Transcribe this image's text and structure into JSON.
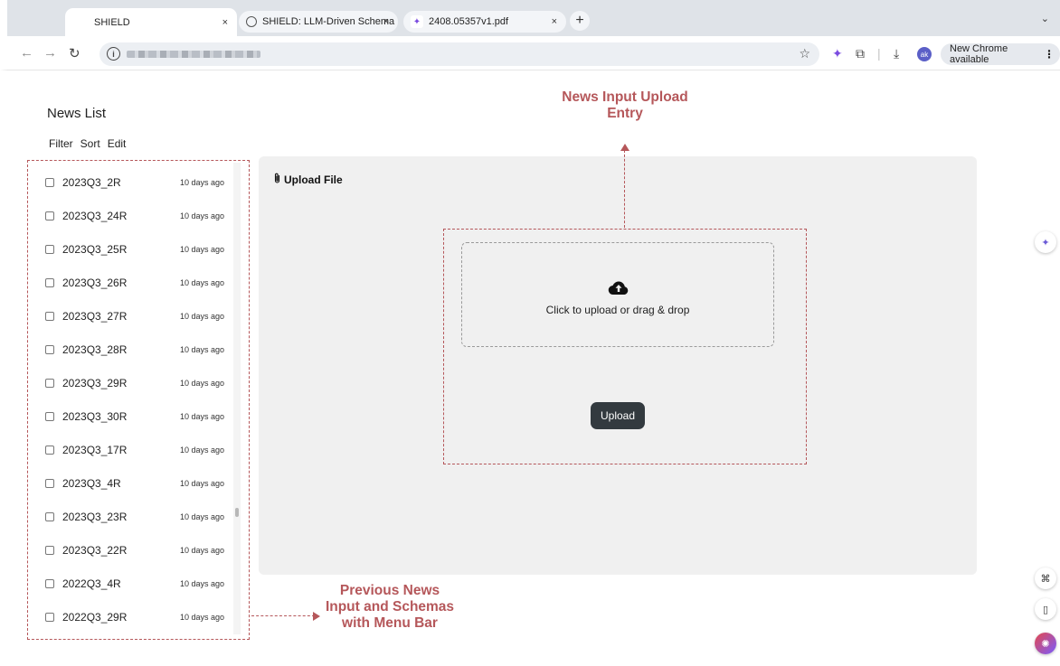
{
  "browser": {
    "tabs": [
      {
        "label": "SHIELD",
        "close": "×",
        "active": true
      },
      {
        "label": "SHIELD: LLM-Driven Schema",
        "close": "×",
        "active": false
      },
      {
        "label": "2408.05357v1.pdf",
        "close": "×",
        "active": false
      }
    ],
    "new_tab": "+",
    "tab_menu": "⌄",
    "update_label": "New Chrome available",
    "avatar_initials": "ak"
  },
  "page": {
    "title": "News List",
    "menu": [
      "Filter",
      "Sort",
      "Edit"
    ]
  },
  "news_items": [
    {
      "name": "2023Q3_2R",
      "time": "10 days ago"
    },
    {
      "name": "2023Q3_24R",
      "time": "10 days ago"
    },
    {
      "name": "2023Q3_25R",
      "time": "10 days ago"
    },
    {
      "name": "2023Q3_26R",
      "time": "10 days ago"
    },
    {
      "name": "2023Q3_27R",
      "time": "10 days ago"
    },
    {
      "name": "2023Q3_28R",
      "time": "10 days ago"
    },
    {
      "name": "2023Q3_29R",
      "time": "10 days ago"
    },
    {
      "name": "2023Q3_30R",
      "time": "10 days ago"
    },
    {
      "name": "2023Q3_17R",
      "time": "10 days ago"
    },
    {
      "name": "2023Q3_4R",
      "time": "10 days ago"
    },
    {
      "name": "2023Q3_23R",
      "time": "10 days ago"
    },
    {
      "name": "2023Q3_22R",
      "time": "10 days ago"
    },
    {
      "name": "2022Q3_4R",
      "time": "10 days ago"
    },
    {
      "name": "2022Q3_29R",
      "time": "10 days ago"
    }
  ],
  "upload": {
    "title": "Upload File",
    "dropzone_text": "Click to upload or drag & drop",
    "button_label": "Upload"
  },
  "annotations": {
    "upload_entry": "News Input Upload Entry",
    "previous_news": "Previous News Input and Schemas with Menu Bar",
    "color": "#b5575a"
  },
  "icons": {
    "attachment": "paperclip-icon",
    "cloud_upload": "cloud-upload-icon"
  }
}
